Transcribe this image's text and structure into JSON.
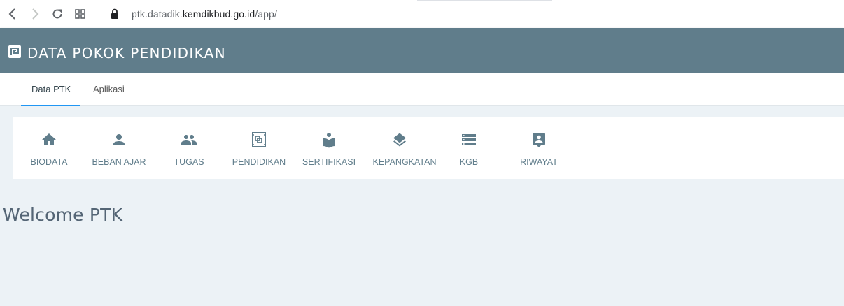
{
  "browser": {
    "url_prefix": "ptk.datadik.",
    "url_domain": "kemdikbud.go.id",
    "url_path": "/app/"
  },
  "header": {
    "title": "DATA POKOK PENDIDIKAN",
    "color": "#607d8b"
  },
  "tabs": [
    {
      "label": "Data PTK",
      "active": true
    },
    {
      "label": "Aplikasi",
      "active": false
    }
  ],
  "menu": [
    {
      "label": "BIODATA",
      "icon": "home-icon"
    },
    {
      "label": "BEBAN AJAR",
      "icon": "person-icon"
    },
    {
      "label": "TUGAS",
      "icon": "people-icon"
    },
    {
      "label": "PENDIDIKAN",
      "icon": "frame-icon"
    },
    {
      "label": "SERTIFIKASI",
      "icon": "book-reader-icon"
    },
    {
      "label": "KEPANGKATAN",
      "icon": "layers-icon"
    },
    {
      "label": "KGB",
      "icon": "list-icon"
    },
    {
      "label": "RIWAYAT",
      "icon": "contact-icon"
    }
  ],
  "main": {
    "welcome": "Welcome PTK"
  }
}
